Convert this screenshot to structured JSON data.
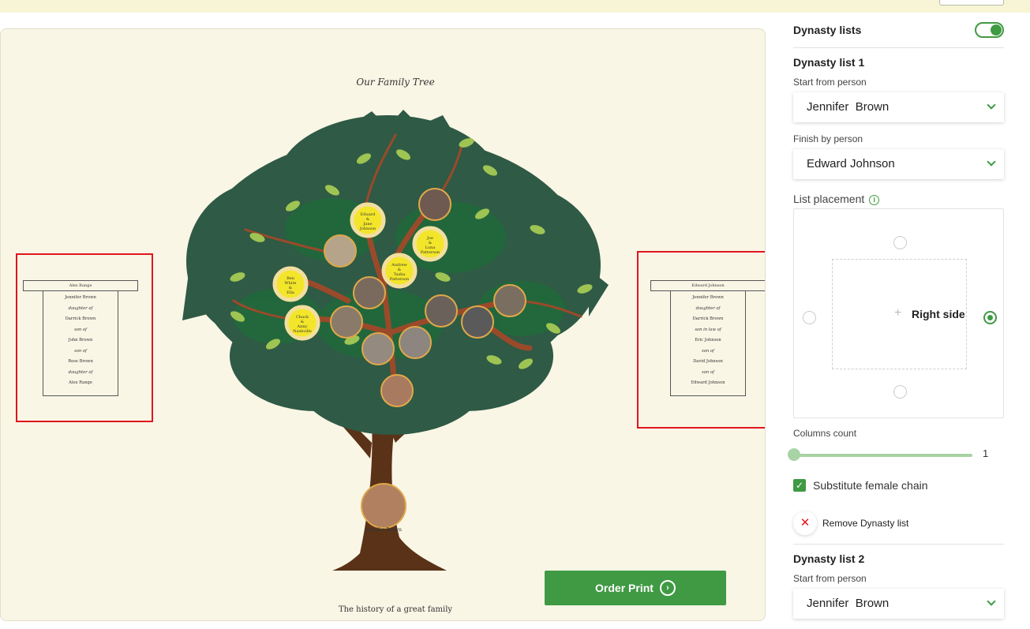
{
  "canvas": {
    "tree_title": "Our Family Tree",
    "tree_subtitle": "The history of a great family",
    "order_print_label": "Order Print",
    "left_list": {
      "header": "Alex Range",
      "entries": [
        "Jennifer Brown",
        "daughter of",
        "Darrick Brown",
        "son of",
        "John Brown",
        "son of",
        "Rose Brown",
        "daughter of",
        "Alex Range"
      ]
    },
    "right_list": {
      "header": "Edward Johnson",
      "entries": [
        "Jennifer Brown",
        "daughter of",
        "Darrick Brown",
        "son in law of",
        "Eric Johnson",
        "son of",
        "David Johnson",
        "son of",
        "Edward Johnson"
      ]
    },
    "root_person": "Jennifer Brown",
    "couples": [
      {
        "text": [
          "Eduard",
          "&",
          "Jane",
          "Johnson"
        ],
        "photo": false
      },
      {
        "text": [
          "Joe",
          "&",
          "Luna",
          "Patterson"
        ],
        "photo": false
      },
      {
        "text": [
          "Andrew",
          "&",
          "Tasha",
          "Patterson"
        ],
        "photo": false
      },
      {
        "text": [
          "Ben",
          "White",
          "&",
          "Ella"
        ],
        "photo": false
      },
      {
        "text": [
          "Chuck",
          "&",
          "Anny",
          "Nashville"
        ],
        "photo": false
      }
    ]
  },
  "panel": {
    "dynasty_lists_title": "Dynasty lists",
    "dynasty_lists_enabled": true,
    "list1": {
      "title": "Dynasty list 1",
      "start_label": "Start from person",
      "start_value": "Jennifer  Brown",
      "finish_label": "Finish by person",
      "finish_value": "Edward Johnson",
      "placement_label": "List placement",
      "placement_value": "Right side",
      "columns_label": "Columns count",
      "columns_value": "1",
      "substitute_label": "Substitute female chain",
      "substitute_checked": true,
      "remove_label": "Remove Dynasty list"
    },
    "list2": {
      "title": "Dynasty list 2",
      "start_label": "Start from person",
      "start_value": "Jennifer  Brown"
    }
  },
  "colors": {
    "accent": "#3f9a43",
    "canvas_bg": "#f9f6e6",
    "selection": "#e0161d",
    "foliage": "#2f5a45",
    "trunk": "#5a3218"
  }
}
